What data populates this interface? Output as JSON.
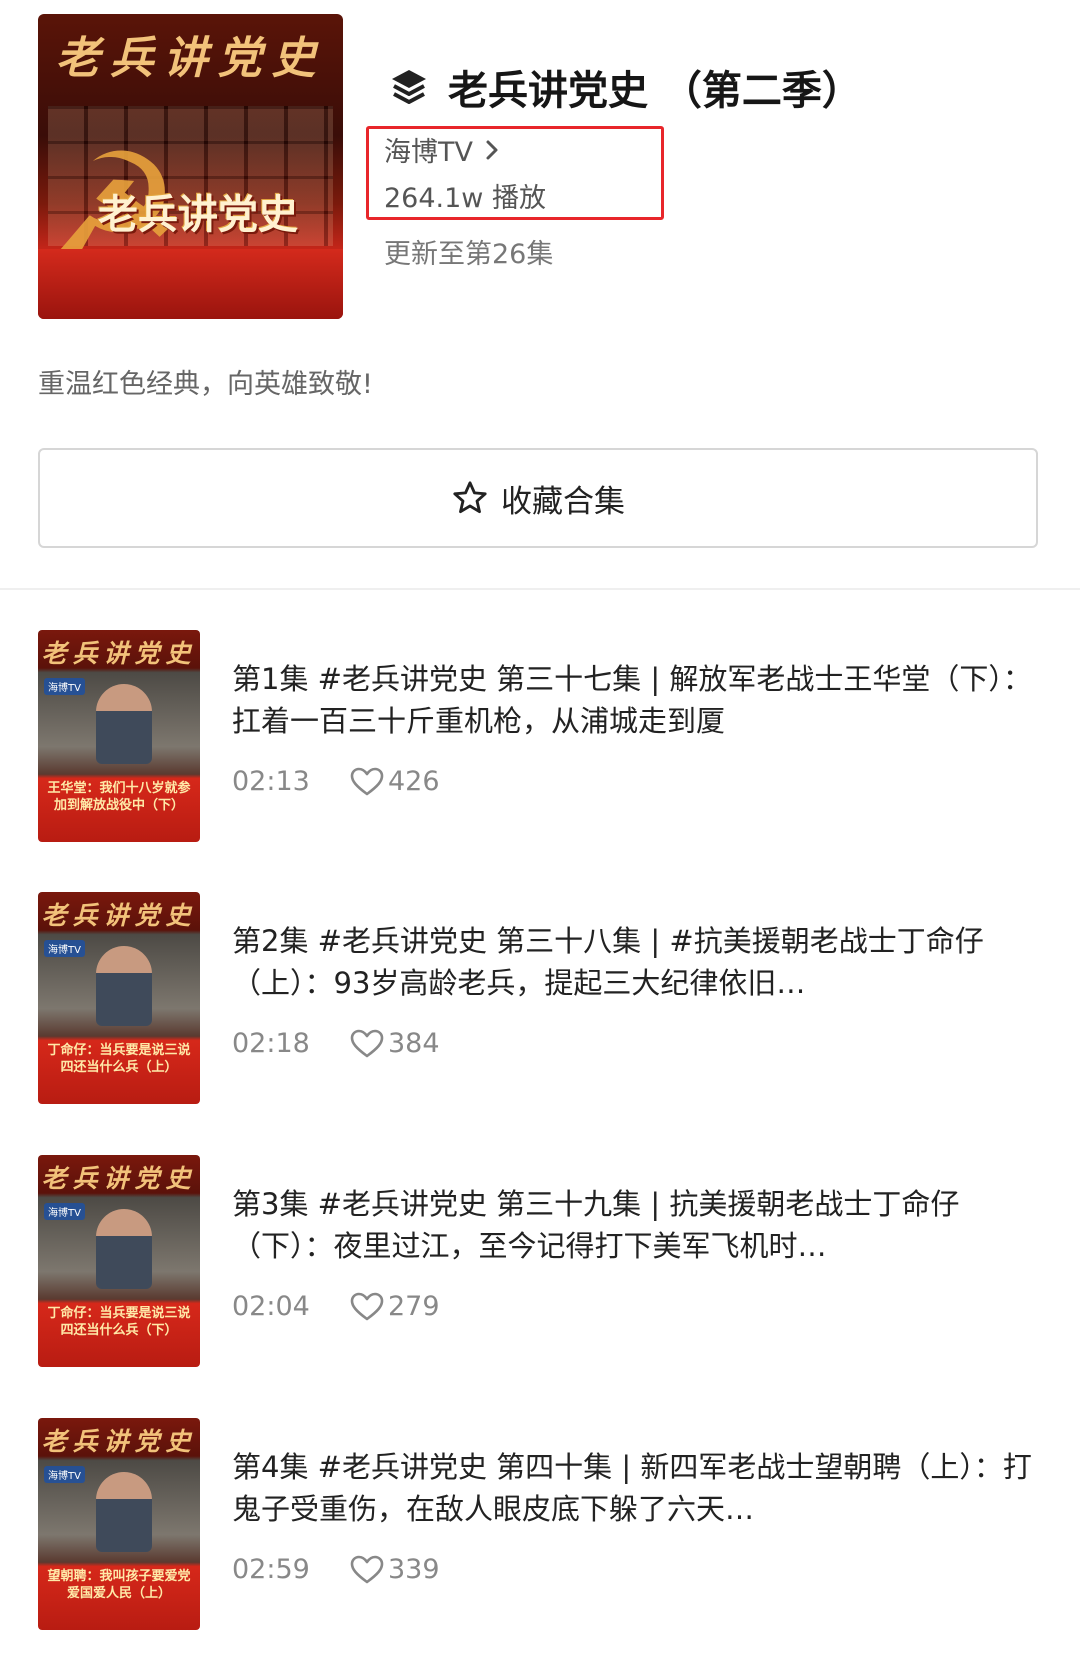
{
  "header": {
    "cover_text_top": "老兵讲党史",
    "cover_text_mid": "老兵讲党史",
    "title": "老兵讲党史 （第二季）",
    "channel": "海博TV",
    "plays": "264.1w 播放",
    "update": "更新至第26集",
    "description": "重温红色经典，向英雄致敬!",
    "favorite_label": "收藏合集",
    "icons": {
      "title": "layers-icon",
      "channel": "chevron-right-icon",
      "favorite": "star-outline-icon"
    },
    "colors": {
      "highlight_box": "#e8262a",
      "cover_red": "#c8261a"
    }
  },
  "thumb_header": "老兵讲党史",
  "thumb_logo": "海博TV",
  "episodes": [
    {
      "title": "第1集  #老兵讲党史 第三十七集 | 解放军老战士王华堂（下）：扛着一百三十斤重机枪，从浦城走到厦",
      "duration": "02:13",
      "likes": "426",
      "thumb_caption": "王华堂：我们十八岁就参加到解放战役中（下）"
    },
    {
      "title": "第2集  #老兵讲党史 第三十八集 | #抗美援朝老战士丁命仔（上）：93岁高龄老兵，提起三大纪律依旧…",
      "duration": "02:18",
      "likes": "384",
      "thumb_caption": "丁命仔：当兵要是说三说四还当什么兵（上）"
    },
    {
      "title": "第3集  #老兵讲党史 第三十九集 | 抗美援朝老战士丁命仔（下）：夜里过江，至今记得打下美军飞机时…",
      "duration": "02:04",
      "likes": "279",
      "thumb_caption": "丁命仔：当兵要是说三说四还当什么兵（下）"
    },
    {
      "title": "第4集  #老兵讲党史 第四十集 | 新四军老战士望朝聘（上）：打鬼子受重伤，在敌人眼皮底下躲了六天…",
      "duration": "02:59",
      "likes": "339",
      "thumb_caption": "望朝聘：我叫孩子要爱党爱国爱人民（上）"
    }
  ]
}
